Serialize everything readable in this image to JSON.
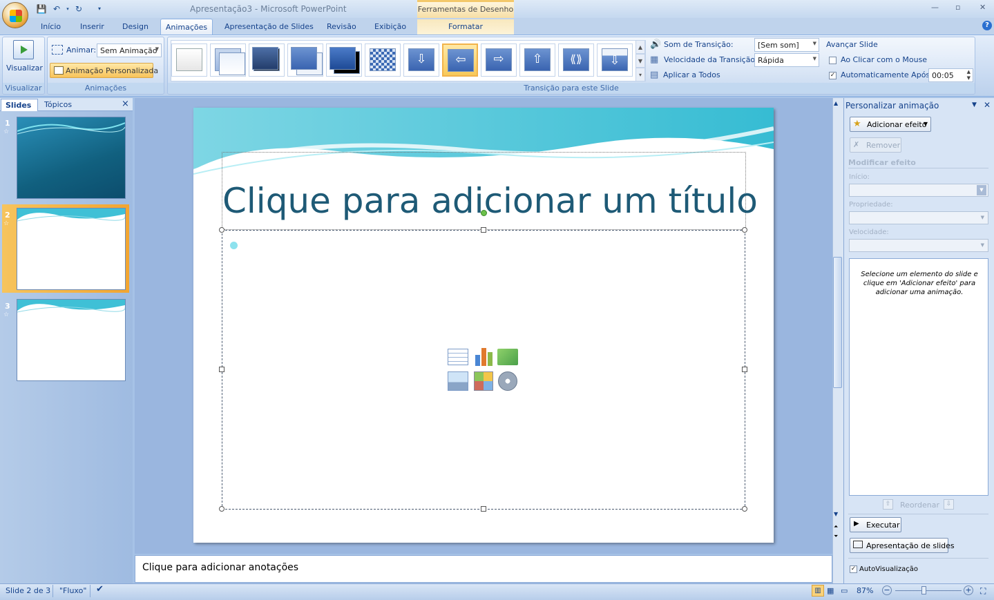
{
  "window": {
    "app_title": "Apresentação3 - Microsoft PowerPoint",
    "context_header": "Ferramentas de Desenho",
    "controls": [
      "—",
      "▫",
      "✕"
    ]
  },
  "tabs": [
    "Início",
    "Inserir",
    "Design",
    "Animações",
    "Apresentação de Slides",
    "Revisão",
    "Exibição",
    "Formatar"
  ],
  "active_tab": "Animações",
  "ribbon": {
    "preview_group": {
      "button_label": "Visualizar",
      "group_label": "Visualizar"
    },
    "animations_group": {
      "animate_label": "Animar:",
      "animate_value": "Sem Animação",
      "custom_animation_label": "Animação Personalizada",
      "group_label": "Animações"
    },
    "transition_group": {
      "group_label": "Transição para este Slide",
      "sound_label": "Som de Transição:",
      "sound_value": "[Sem som]",
      "speed_label": "Velocidade da Transição:",
      "speed_value": "Rápida",
      "apply_all_label": "Aplicar a Todos",
      "advance_title": "Avançar Slide",
      "on_click_label": "Ao Clicar com o Mouse",
      "on_click_checked": false,
      "auto_after_label": "Automaticamente Após:",
      "auto_after_checked": true,
      "auto_after_value": "00:05"
    }
  },
  "left_pane": {
    "tab_slides": "Slides",
    "tab_outline": "Tópicos",
    "close": "×",
    "slides": [
      {
        "number": "1",
        "selected": false
      },
      {
        "number": "2",
        "selected": true
      },
      {
        "number": "3",
        "selected": false
      }
    ]
  },
  "slide": {
    "title_placeholder": "Clique para adicionar um título"
  },
  "notes": {
    "placeholder": "Clique para adicionar anotações"
  },
  "task_pane": {
    "title": "Personalizar animação",
    "add_effect": "Adicionar efeito",
    "remove": "Remover",
    "modify_effect": "Modificar efeito",
    "start_label": "Início:",
    "property_label": "Propriedade:",
    "speed_label": "Velocidade:",
    "hint": "Selecione um elemento do slide e clique em 'Adicionar efeito' para adicionar uma animação.",
    "reorder": "Reordenar",
    "play": "Executar",
    "slide_show": "Apresentação de slides",
    "autopreview": "AutoVisualização",
    "autopreview_checked": true
  },
  "status_bar": {
    "slide_info": "Slide 2 de 3",
    "theme": "\"Fluxo\"",
    "zoom": "87%",
    "zoom_fraction": 0.87
  }
}
